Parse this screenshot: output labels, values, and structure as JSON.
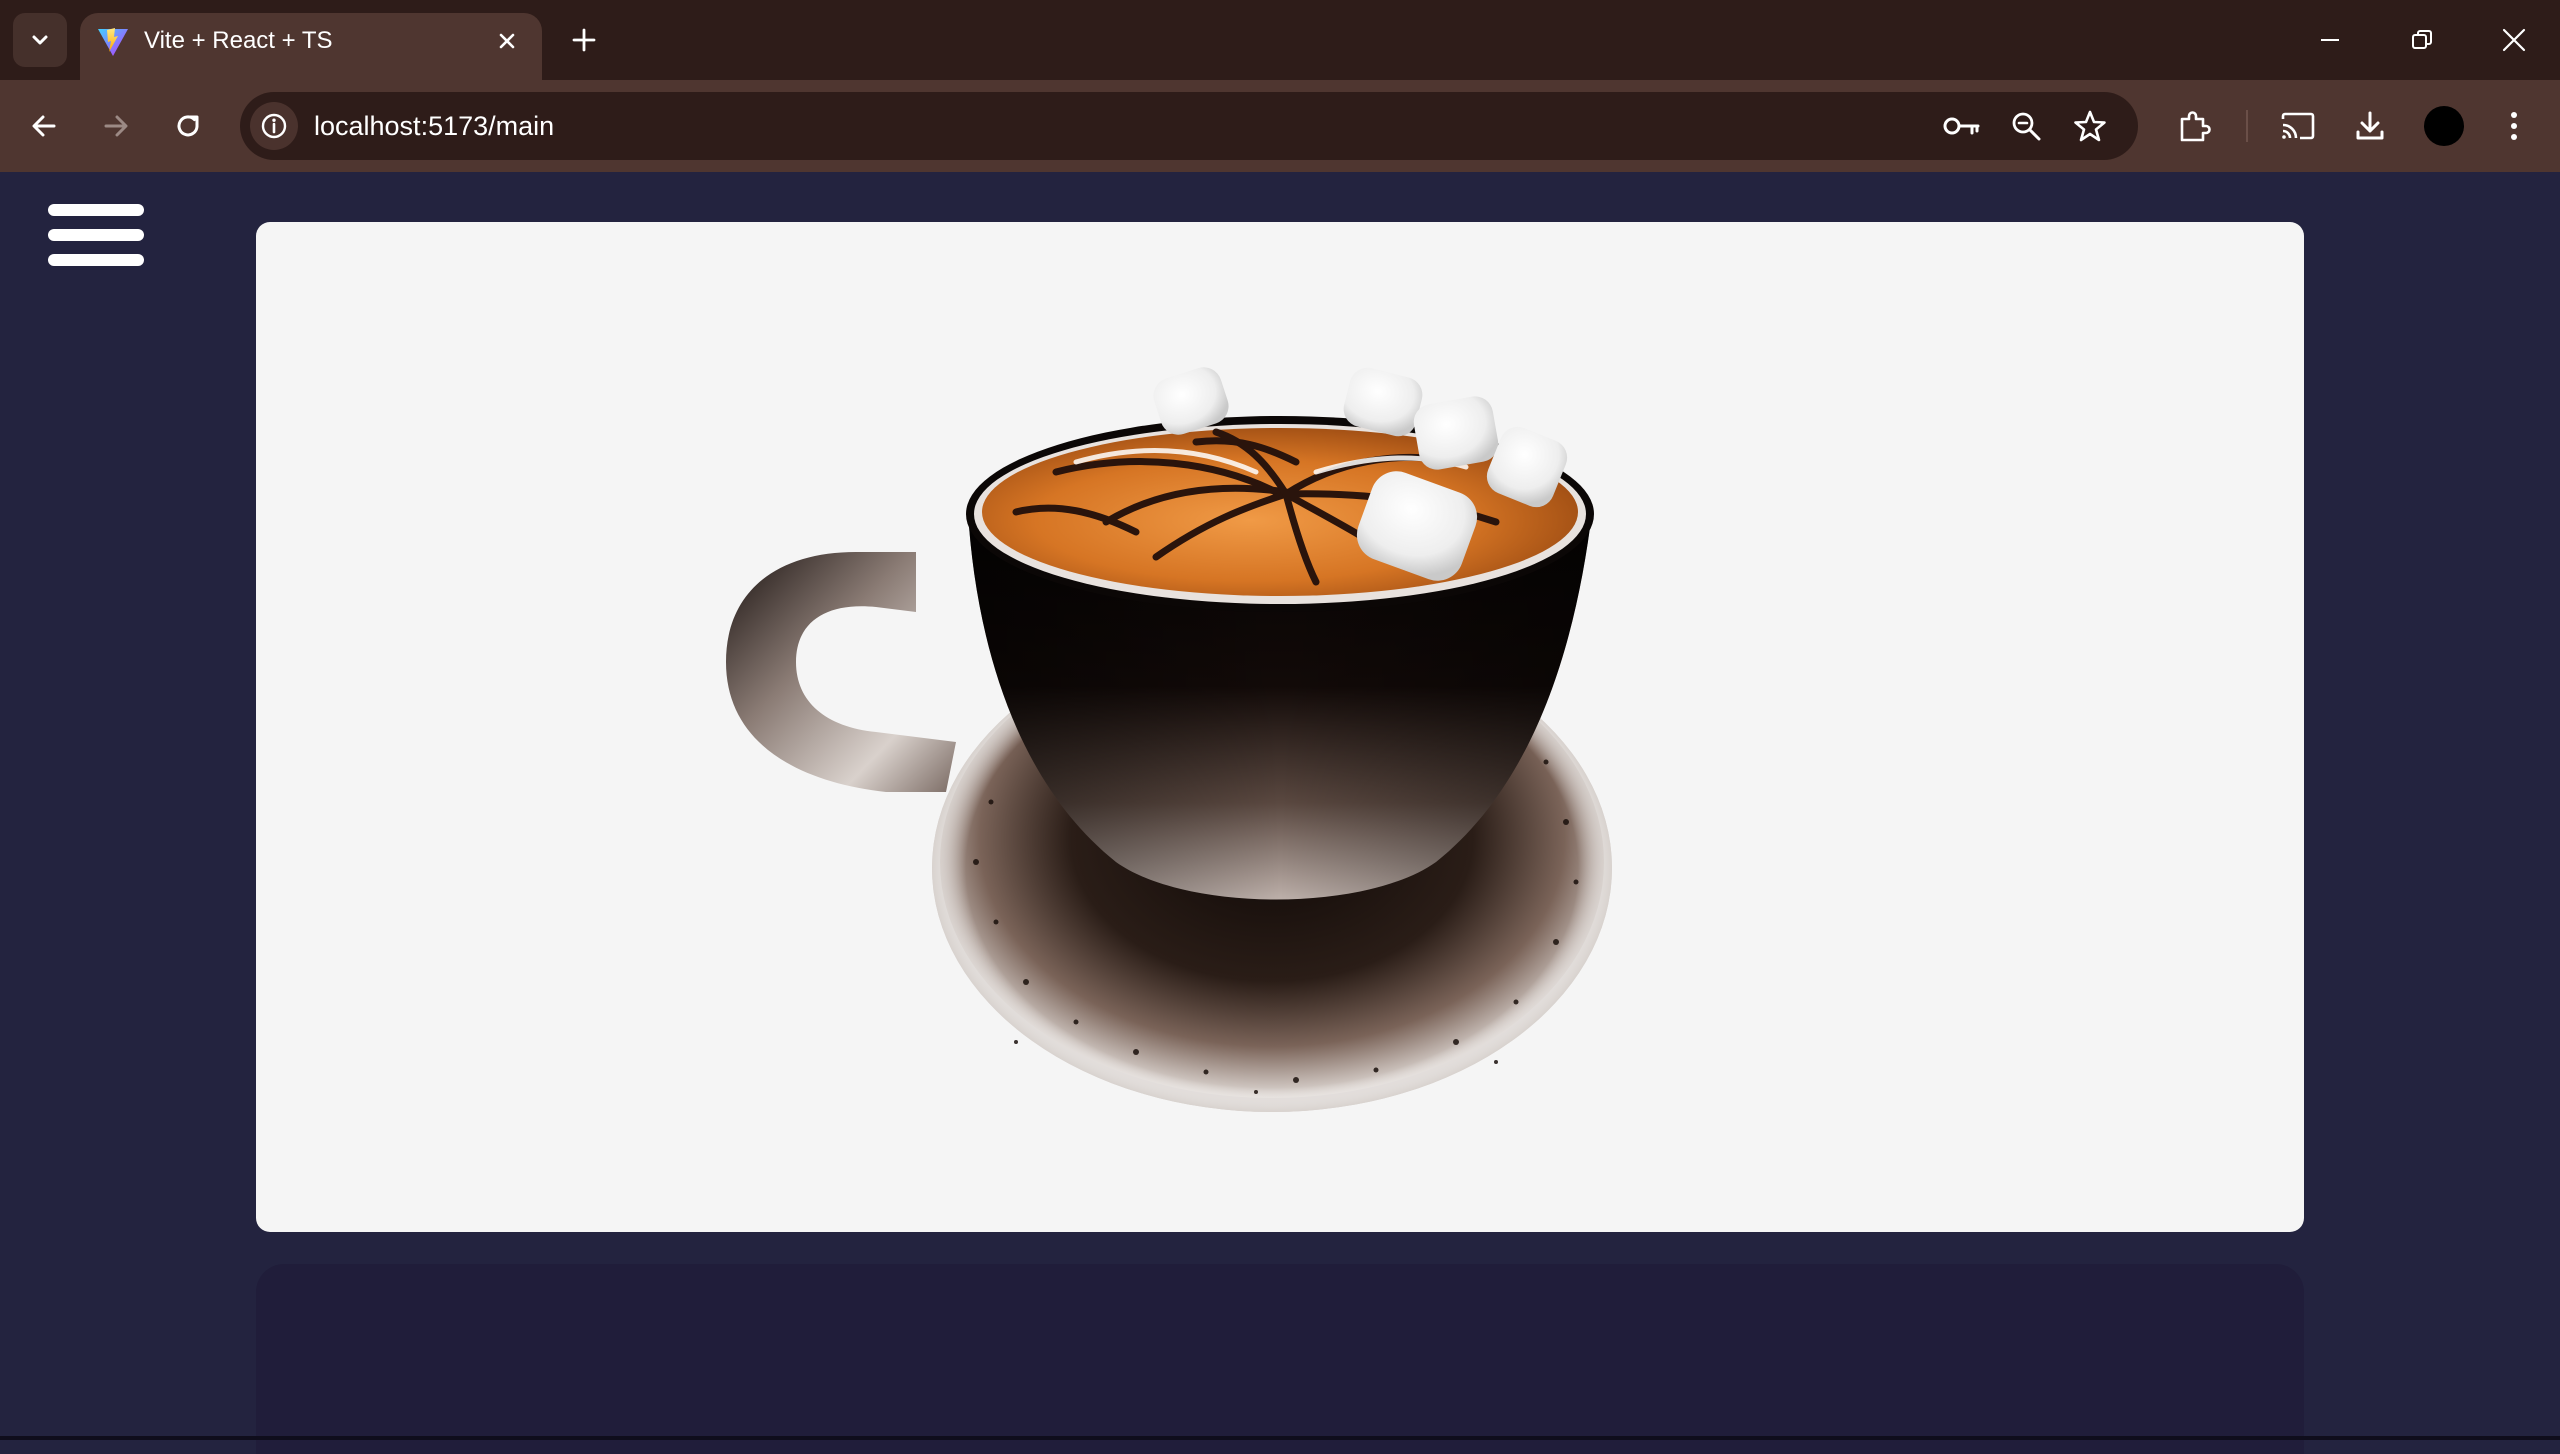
{
  "browser": {
    "tab": {
      "title": "Vite + React + TS",
      "favicon": "vite-logo"
    },
    "address_bar": {
      "url": "localhost:5173/main"
    },
    "icons": {
      "tab_search": "chevron-down-icon",
      "close_tab": "close-icon",
      "new_tab": "plus-icon",
      "minimize": "minimize-icon",
      "restore": "restore-icon",
      "close_window": "close-icon",
      "back": "arrow-left-icon",
      "forward": "arrow-right-icon",
      "reload": "reload-icon",
      "site_info": "info-icon",
      "passwords": "key-icon",
      "zoom": "zoom-out-icon",
      "bookmark": "star-icon",
      "extensions": "puzzle-icon",
      "cast": "cast-icon",
      "downloads": "download-icon",
      "menu": "kebab-menu-icon"
    },
    "colors": {
      "tabstrip": "#2e1c19",
      "toolbar": "#4f3630",
      "omnibox": "#2e1c19"
    }
  },
  "page": {
    "menu_icon": "hamburger-icon",
    "viewer": {
      "subject": "3d-coffee-cup-model"
    },
    "colors": {
      "background": "#23233f",
      "viewer_card": "#f5f5f5",
      "lower_panel": "#201d3a"
    }
  }
}
